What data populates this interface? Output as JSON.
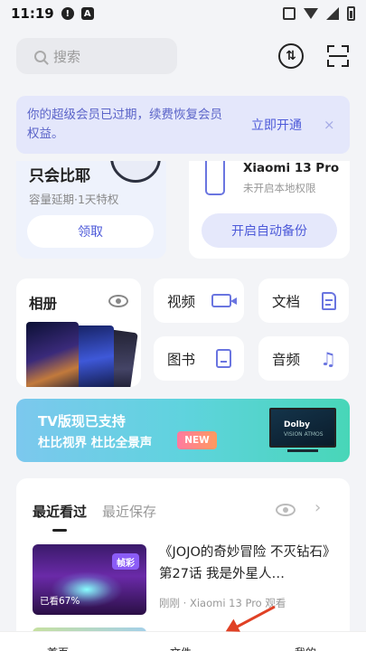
{
  "status_bar": {
    "time": "11:19",
    "notif_icons": [
      "alert-icon",
      "a-letter-icon"
    ],
    "sys_icons": [
      "vibrate-icon",
      "wifi-icon",
      "signal-icon",
      "battery-icon"
    ]
  },
  "header": {
    "search_placeholder": "搜索",
    "icons": [
      "sync-icon",
      "scan-icon"
    ]
  },
  "banner": {
    "message": "你的超级会员已过期，续费恢复会员权益。",
    "action": "立即开通",
    "close": "×"
  },
  "vip_card": {
    "title": "只会比耶",
    "subtitle": "容量延期·1天特权",
    "button": "领取"
  },
  "device_card": {
    "name": "Xiaomi 13 Pro",
    "status": "未开启本地权限",
    "button": "开启自动备份"
  },
  "album": {
    "label": "相册"
  },
  "tiles": [
    {
      "label": "视频",
      "icon": "video-icon"
    },
    {
      "label": "文档",
      "icon": "document-icon"
    },
    {
      "label": "图书",
      "icon": "book-icon"
    },
    {
      "label": "音频",
      "icon": "music-icon"
    }
  ],
  "tv_banner": {
    "title": "TV版现已支持",
    "subtitle": "杜比视界 杜比全景声",
    "badge": "NEW",
    "tv_brand": "Dolby",
    "tv_sub": "VISION ATMOS"
  },
  "recent": {
    "tabs": [
      "最近看过",
      "最近保存"
    ],
    "items": [
      {
        "title": "《JOJO的奇妙冒险 不灭钻石》第27话 我是外星人…",
        "badge": "帧彩",
        "progress": "已看67%",
        "meta": "刚刚 · Xiaomi 13 Pro 观看"
      }
    ]
  },
  "nav": {
    "items": [
      "首页",
      "文件",
      "我的"
    ]
  },
  "colors": {
    "accent": "#4d5ad9",
    "banner_bg": "#e4e7fb",
    "arrow": "#e04125"
  }
}
